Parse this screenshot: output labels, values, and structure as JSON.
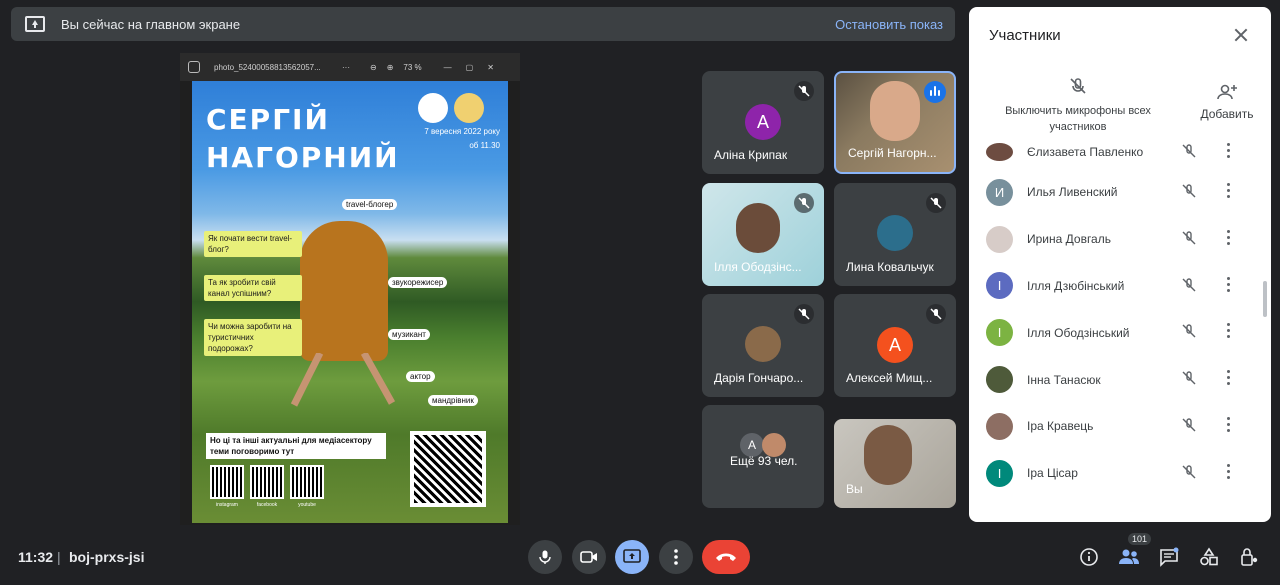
{
  "banner": {
    "text": "Вы сейчас на главном экране",
    "stop_label": "Остановить показ"
  },
  "viewer": {
    "filename": "photo_52400058813562057...",
    "menu_dots": "···",
    "zoom": "73 %"
  },
  "poster": {
    "title1": "СЕРГІЙ",
    "title2": "НАГОРНИЙ",
    "date_line1": "7 вересня 2022 року",
    "date_line2": "об 11.30",
    "q1": "Як почати вести travel-блог?",
    "q2": "Та як зробити свій канал успішним?",
    "q3": "Чи можна заробити на туристичних подорожах?",
    "tag1": "travel-блогер",
    "tag2": "звукорежисер",
    "tag3": "музикант",
    "tag4": "актор",
    "tag5": "мандрівник",
    "bottom_text": "Но ці та інші актуальні для медіасектору теми поговоримо тут",
    "qr1": "instagram",
    "qr2": "facebook",
    "qr3": "youtube"
  },
  "tiles": [
    {
      "name": "Аліна Крипак",
      "initial": "А",
      "color": "#8e24aa",
      "muted": true
    },
    {
      "name": "Сергій Нагорн...",
      "active": true
    },
    {
      "name": "Ілля Ободзінс...",
      "muted": true
    },
    {
      "name": "Лина Ковальчук",
      "muted": true
    },
    {
      "name": "Дарія Гончаро...",
      "muted": true
    },
    {
      "name": "Алексей Мищ...",
      "initial": "А",
      "color": "#f4511e",
      "muted": true
    },
    {
      "name": "Ещё 93 чел.",
      "initial": "А"
    },
    {
      "name": "Вы"
    }
  ],
  "panel": {
    "title": "Участники",
    "mute_all": "Выключить микрофоны всех участников",
    "add": "Добавить",
    "participants": [
      {
        "name": "Єлизавета Павленко",
        "initial": "",
        "color": "#6d4c41"
      },
      {
        "name": "Илья Ливенский",
        "initial": "И",
        "color": "#78909c"
      },
      {
        "name": "Ирина Довгаль",
        "initial": "",
        "color": "#d7ccc8"
      },
      {
        "name": "Ілля Дзюбінський",
        "initial": "І",
        "color": "#5c6bc0"
      },
      {
        "name": "Ілля Ободзінський",
        "initial": "І",
        "color": "#7cb342"
      },
      {
        "name": "Інна Танасюк",
        "initial": "",
        "color": "#4e5a3a"
      },
      {
        "name": "Іра Кравець",
        "initial": "",
        "color": "#8d6e63"
      },
      {
        "name": "Іра Цісар",
        "initial": "І",
        "color": "#00897b"
      }
    ]
  },
  "bottom": {
    "time": "11:32",
    "separator": "|",
    "meeting_code": "boj-prxs-jsi",
    "participants_count": "101"
  }
}
